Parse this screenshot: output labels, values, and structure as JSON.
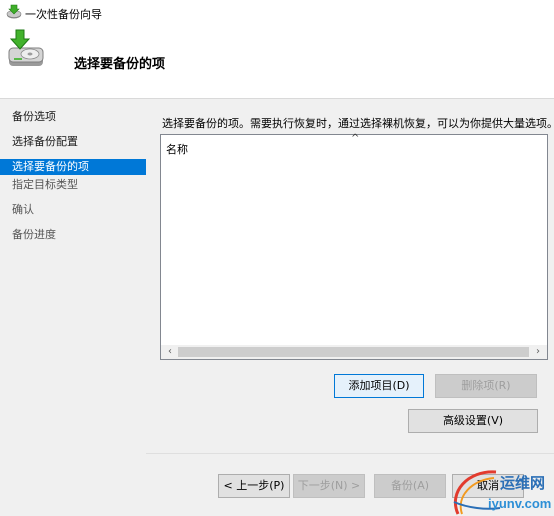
{
  "window": {
    "title": "一次性备份向导"
  },
  "header": {
    "heading": "选择要备份的项"
  },
  "sidebar": {
    "items": [
      {
        "label": "备份选项"
      },
      {
        "label": "选择备份配置"
      },
      {
        "label": "选择要备份的项"
      },
      {
        "label": "指定目标类型"
      },
      {
        "label": "确认"
      },
      {
        "label": "备份进度"
      }
    ]
  },
  "main": {
    "description": "选择要备份的项。需要执行恢复时，通过选择裸机恢复，可以为你提供大量选项。",
    "list": {
      "column_header": "名称",
      "sort_indicator": "^"
    },
    "buttons": {
      "add_item": "添加项目(D)",
      "remove_item": "删除项(R)",
      "advanced": "高级设置(V)"
    }
  },
  "footer": {
    "prev": "< 上一步(P)",
    "next": "下一步(N) >",
    "backup": "备份(A)",
    "cancel": "取消"
  },
  "watermark": {
    "line1": "运维网",
    "line2": "iyunv.com"
  },
  "colors": {
    "accent": "#0078d7",
    "sidebar_bg": "#f0f0f0",
    "content_bg": "#f0f0f0"
  }
}
